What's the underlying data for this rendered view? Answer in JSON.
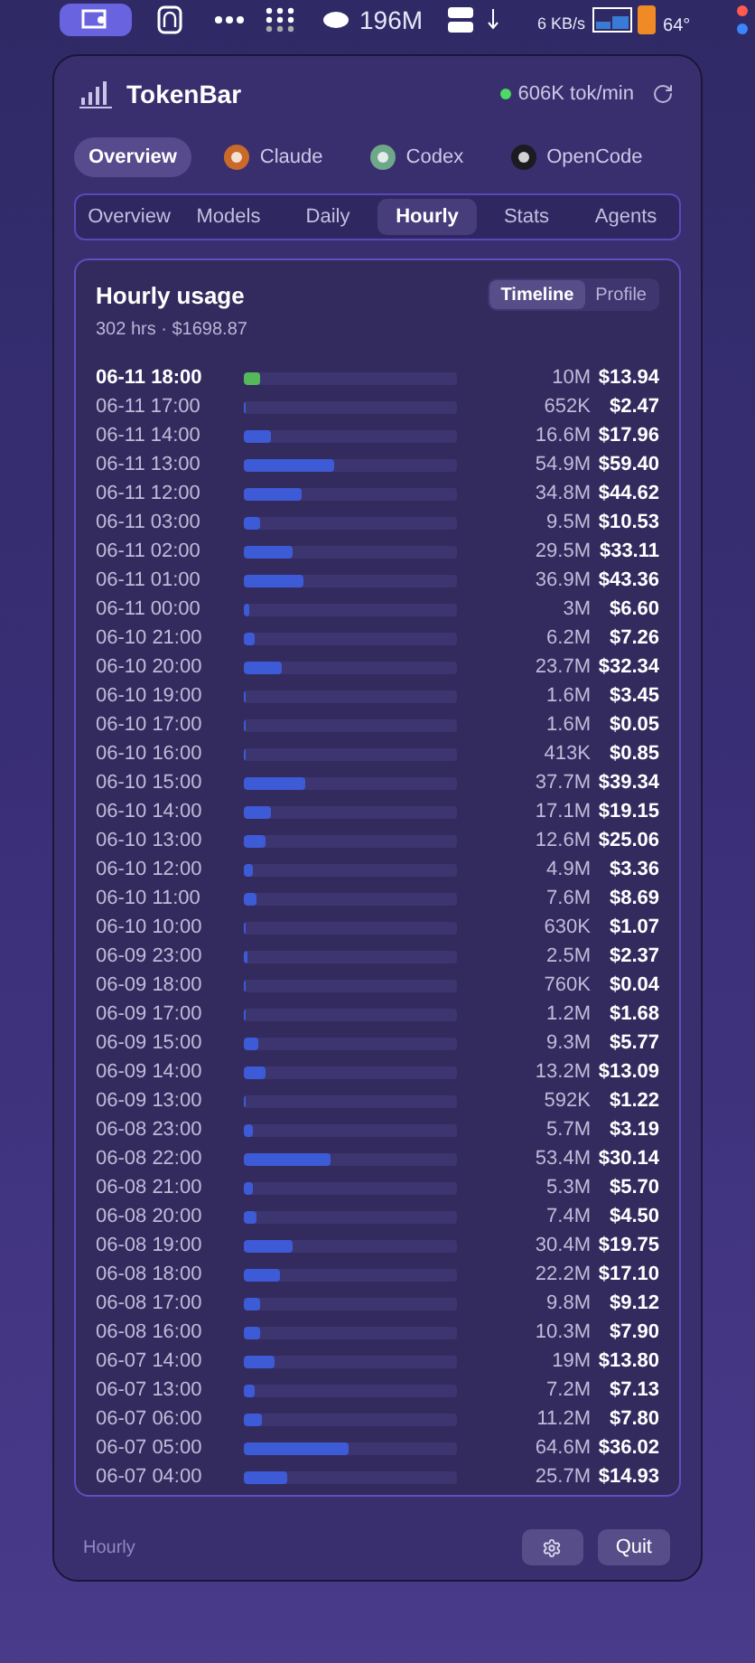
{
  "menu_bar": {
    "memory": "196M",
    "net_down": "6 KB/s",
    "temp": "64°"
  },
  "app": {
    "title": "TokenBar",
    "rate": "606K tok/min",
    "live": true
  },
  "providers": [
    {
      "label": "Overview",
      "selected": true,
      "kind": "all"
    },
    {
      "label": "Claude",
      "selected": false,
      "kind": "vendor",
      "color": "#c96a2a"
    },
    {
      "label": "Codex",
      "selected": false,
      "kind": "vendor",
      "color": "#6fa78a"
    },
    {
      "label": "OpenCode",
      "selected": false,
      "kind": "vendor",
      "color": "#1c1b22"
    }
  ],
  "tabs": [
    {
      "label": "Overview",
      "selected": false
    },
    {
      "label": "Models",
      "selected": false
    },
    {
      "label": "Daily",
      "selected": false
    },
    {
      "label": "Hourly",
      "selected": true
    },
    {
      "label": "Stats",
      "selected": false
    },
    {
      "label": "Agents",
      "selected": false
    }
  ],
  "card": {
    "title": "Hourly usage",
    "subtitle": "302 hrs · $1698.87",
    "views": [
      {
        "label": "Timeline",
        "selected": true
      },
      {
        "label": "Profile",
        "selected": false
      }
    ]
  },
  "rows": [
    {
      "time": "06-11 18:00",
      "tokens": "10M",
      "cost": "$13.94",
      "level": 0.08,
      "current": true
    },
    {
      "time": "06-11 17:00",
      "tokens": "652K",
      "cost": "$2.47",
      "level": 0.005,
      "current": false
    },
    {
      "time": "06-11 14:00",
      "tokens": "16.6M",
      "cost": "$17.96",
      "level": 0.127,
      "current": false
    },
    {
      "time": "06-11 13:00",
      "tokens": "54.9M",
      "cost": "$59.40",
      "level": 0.42,
      "current": false
    },
    {
      "time": "06-11 12:00",
      "tokens": "34.8M",
      "cost": "$44.62",
      "level": 0.27,
      "current": false
    },
    {
      "time": "06-11 03:00",
      "tokens": "9.5M",
      "cost": "$10.53",
      "level": 0.075,
      "current": false
    },
    {
      "time": "06-11 02:00",
      "tokens": "29.5M",
      "cost": "$33.11",
      "level": 0.23,
      "current": false
    },
    {
      "time": "06-11 01:00",
      "tokens": "36.9M",
      "cost": "$43.36",
      "level": 0.28,
      "current": false
    },
    {
      "time": "06-11 00:00",
      "tokens": "3M",
      "cost": "$6.60",
      "level": 0.023,
      "current": false
    },
    {
      "time": "06-10 21:00",
      "tokens": "6.2M",
      "cost": "$7.26",
      "level": 0.05,
      "current": false
    },
    {
      "time": "06-10 20:00",
      "tokens": "23.7M",
      "cost": "$32.34",
      "level": 0.18,
      "current": false
    },
    {
      "time": "06-10 19:00",
      "tokens": "1.6M",
      "cost": "$3.45",
      "level": 0.012,
      "current": false
    },
    {
      "time": "06-10 17:00",
      "tokens": "1.6M",
      "cost": "$0.05",
      "level": 0.012,
      "current": false
    },
    {
      "time": "06-10 16:00",
      "tokens": "413K",
      "cost": "$0.85",
      "level": 0.003,
      "current": false
    },
    {
      "time": "06-10 15:00",
      "tokens": "37.7M",
      "cost": "$39.34",
      "level": 0.29,
      "current": false
    },
    {
      "time": "06-10 14:00",
      "tokens": "17.1M",
      "cost": "$19.15",
      "level": 0.13,
      "current": false
    },
    {
      "time": "06-10 13:00",
      "tokens": "12.6M",
      "cost": "$25.06",
      "level": 0.1,
      "current": false
    },
    {
      "time": "06-10 12:00",
      "tokens": "4.9M",
      "cost": "$3.36",
      "level": 0.04,
      "current": false
    },
    {
      "time": "06-10 11:00",
      "tokens": "7.6M",
      "cost": "$8.69",
      "level": 0.06,
      "current": false
    },
    {
      "time": "06-10 10:00",
      "tokens": "630K",
      "cost": "$1.07",
      "level": 0.005,
      "current": false
    },
    {
      "time": "06-09 23:00",
      "tokens": "2.5M",
      "cost": "$2.37",
      "level": 0.02,
      "current": false
    },
    {
      "time": "06-09 18:00",
      "tokens": "760K",
      "cost": "$0.04",
      "level": 0.006,
      "current": false
    },
    {
      "time": "06-09 17:00",
      "tokens": "1.2M",
      "cost": "$1.68",
      "level": 0.01,
      "current": false
    },
    {
      "time": "06-09 15:00",
      "tokens": "9.3M",
      "cost": "$5.77",
      "level": 0.07,
      "current": false
    },
    {
      "time": "06-09 14:00",
      "tokens": "13.2M",
      "cost": "$13.09",
      "level": 0.1,
      "current": false
    },
    {
      "time": "06-09 13:00",
      "tokens": "592K",
      "cost": "$1.22",
      "level": 0.005,
      "current": false
    },
    {
      "time": "06-08 23:00",
      "tokens": "5.7M",
      "cost": "$3.19",
      "level": 0.044,
      "current": false
    },
    {
      "time": "06-08 22:00",
      "tokens": "53.4M",
      "cost": "$30.14",
      "level": 0.41,
      "current": false
    },
    {
      "time": "06-08 21:00",
      "tokens": "5.3M",
      "cost": "$5.70",
      "level": 0.04,
      "current": false
    },
    {
      "time": "06-08 20:00",
      "tokens": "7.4M",
      "cost": "$4.50",
      "level": 0.057,
      "current": false
    },
    {
      "time": "06-08 19:00",
      "tokens": "30.4M",
      "cost": "$19.75",
      "level": 0.23,
      "current": false
    },
    {
      "time": "06-08 18:00",
      "tokens": "22.2M",
      "cost": "$17.10",
      "level": 0.17,
      "current": false
    },
    {
      "time": "06-08 17:00",
      "tokens": "9.8M",
      "cost": "$9.12",
      "level": 0.075,
      "current": false
    },
    {
      "time": "06-08 16:00",
      "tokens": "10.3M",
      "cost": "$7.90",
      "level": 0.08,
      "current": false
    },
    {
      "time": "06-07 14:00",
      "tokens": "19M",
      "cost": "$13.80",
      "level": 0.145,
      "current": false
    },
    {
      "time": "06-07 13:00",
      "tokens": "7.2M",
      "cost": "$7.13",
      "level": 0.055,
      "current": false
    },
    {
      "time": "06-07 06:00",
      "tokens": "11.2M",
      "cost": "$7.80",
      "level": 0.085,
      "current": false
    },
    {
      "time": "06-07 05:00",
      "tokens": "64.6M",
      "cost": "$36.02",
      "level": 0.49,
      "current": false
    },
    {
      "time": "06-07 04:00",
      "tokens": "25.7M",
      "cost": "$14.93",
      "level": 0.2,
      "current": false
    }
  ],
  "footer": {
    "label": "Hourly",
    "quit": "Quit"
  }
}
